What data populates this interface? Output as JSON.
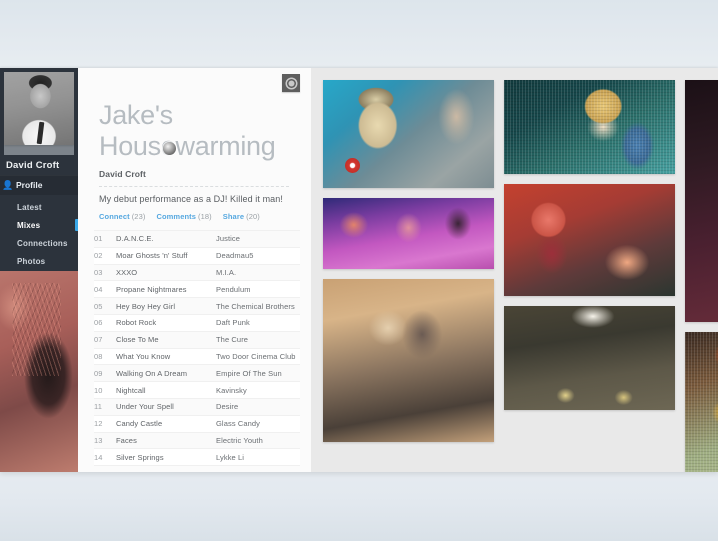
{
  "sidebar": {
    "user_name": "David Croft",
    "avatar_name": "user-avatar-photo",
    "profile": {
      "label": "Profile",
      "icon": "person-icon"
    },
    "items": [
      {
        "label": "Latest",
        "active": false
      },
      {
        "label": "Mixes",
        "active": true
      },
      {
        "label": "Connections",
        "active": false
      },
      {
        "label": "Photos",
        "active": false
      }
    ]
  },
  "content": {
    "title": "Jake's Housewarming",
    "author": "David Croft",
    "description": "My debut performance as a DJ! Killed it man!",
    "gear_button": "settings-gear-button",
    "links": [
      {
        "label": "Connect",
        "count": "(23)"
      },
      {
        "label": "Comments",
        "count": "(18)"
      },
      {
        "label": "Share",
        "count": "(20)"
      }
    ],
    "tracks": [
      {
        "no": "01",
        "title": "D.A.N.C.E.",
        "artist": "Justice"
      },
      {
        "no": "02",
        "title": "Moar Ghosts 'n' Stuff",
        "artist": "Deadmau5"
      },
      {
        "no": "03",
        "title": "XXXO",
        "artist": "M.I.A."
      },
      {
        "no": "04",
        "title": "Propane Nightmares",
        "artist": "Pendulum"
      },
      {
        "no": "05",
        "title": "Hey Boy Hey Girl",
        "artist": "The Chemical Brothers"
      },
      {
        "no": "06",
        "title": "Robot Rock",
        "artist": "Daft Punk"
      },
      {
        "no": "07",
        "title": "Close To Me",
        "artist": "The Cure"
      },
      {
        "no": "08",
        "title": "What You Know",
        "artist": "Two Door Cinema Club"
      },
      {
        "no": "09",
        "title": "Walking On A Dream",
        "artist": "Empire Of The Sun"
      },
      {
        "no": "10",
        "title": "Nightcall",
        "artist": "Kavinsky"
      },
      {
        "no": "11",
        "title": "Under Your Spell",
        "artist": "Desire"
      },
      {
        "no": "12",
        "title": "Candy Castle",
        "artist": "Glass Candy"
      },
      {
        "no": "13",
        "title": "Faces",
        "artist": "Electric Youth"
      },
      {
        "no": "14",
        "title": "Silver Springs",
        "artist": "Lykke Li"
      }
    ]
  },
  "gallery": {
    "columns": [
      [
        "party-photo-blonde-woman",
        "party-photo-purple-crowd",
        "party-photo-two-men-wall"
      ],
      [
        "party-photo-man-glasses",
        "party-photo-red-hands",
        "party-photo-legs-shoes"
      ],
      [
        "party-photo-man-dark-red",
        "party-photo-green-shirt"
      ]
    ]
  },
  "colors": {
    "sidebar_bg": "#2c333c",
    "accent_blue": "#56a8e0",
    "active_tab": "#3aa8e8",
    "gallery_bg": "#e9e9e9",
    "panel_bg": "#fbfbfb",
    "title_gray": "#b6bcc1"
  }
}
